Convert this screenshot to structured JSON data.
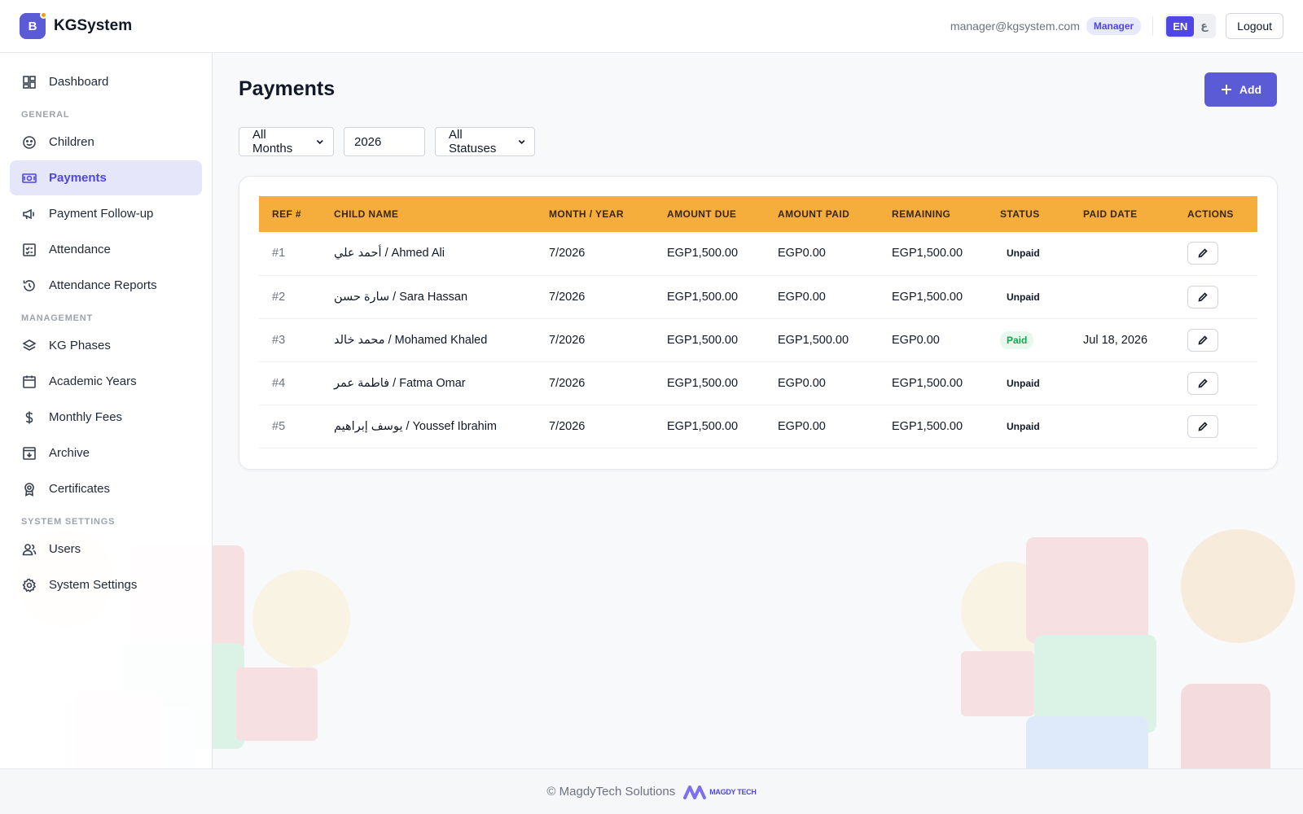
{
  "header": {
    "brand_letter": "B",
    "brand_name": "KGSystem",
    "user_email": "manager@kgsystem.com",
    "role": "Manager",
    "lang_en": "EN",
    "lang_ar": "ع",
    "logout": "Logout"
  },
  "sidebar": {
    "dashboard": "Dashboard",
    "section_general": "GENERAL",
    "children": "Children",
    "payments": "Payments",
    "payment_followup": "Payment Follow-up",
    "attendance": "Attendance",
    "attendance_reports": "Attendance Reports",
    "section_management": "MANAGEMENT",
    "kg_phases": "KG Phases",
    "academic_years": "Academic Years",
    "monthly_fees": "Monthly Fees",
    "archive": "Archive",
    "certificates": "Certificates",
    "section_system": "SYSTEM SETTINGS",
    "users": "Users",
    "system_settings": "System Settings"
  },
  "main": {
    "title": "Payments",
    "add_label": "Add",
    "filters": {
      "month": "All Months",
      "year": "2026",
      "status": "All Statuses"
    },
    "table": {
      "headers": {
        "ref": "REF #",
        "child": "CHILD NAME",
        "month": "MONTH / YEAR",
        "due": "AMOUNT DUE",
        "paid": "AMOUNT PAID",
        "remaining": "REMAINING",
        "status": "STATUS",
        "paid_date": "PAID DATE",
        "actions": "ACTIONS"
      },
      "rows": [
        {
          "ref": "#1",
          "child": "أحمد علي / Ahmed Ali",
          "month": "7/2026",
          "due": "EGP1,500.00",
          "paid": "EGP0.00",
          "remaining": "EGP1,500.00",
          "status": "Unpaid",
          "paid_date": ""
        },
        {
          "ref": "#2",
          "child": "سارة حسن / Sara Hassan",
          "month": "7/2026",
          "due": "EGP1,500.00",
          "paid": "EGP0.00",
          "remaining": "EGP1,500.00",
          "status": "Unpaid",
          "paid_date": ""
        },
        {
          "ref": "#3",
          "child": "محمد خالد / Mohamed Khaled",
          "month": "7/2026",
          "due": "EGP1,500.00",
          "paid": "EGP1,500.00",
          "remaining": "EGP0.00",
          "status": "Paid",
          "paid_date": "Jul 18, 2026"
        },
        {
          "ref": "#4",
          "child": "فاطمة عمر / Fatma Omar",
          "month": "7/2026",
          "due": "EGP1,500.00",
          "paid": "EGP0.00",
          "remaining": "EGP1,500.00",
          "status": "Unpaid",
          "paid_date": ""
        },
        {
          "ref": "#5",
          "child": "يوسف إبراهيم / Youssef Ibrahim",
          "month": "7/2026",
          "due": "EGP1,500.00",
          "paid": "EGP0.00",
          "remaining": "EGP1,500.00",
          "status": "Unpaid",
          "paid_date": ""
        }
      ]
    }
  },
  "footer": {
    "copyright": "© MagdyTech Solutions",
    "logo_text": "MAGDY TECH"
  },
  "colors": {
    "accent": "#5b5bd6",
    "table_header": "#f5ae3c",
    "paid": "#16a34a"
  }
}
